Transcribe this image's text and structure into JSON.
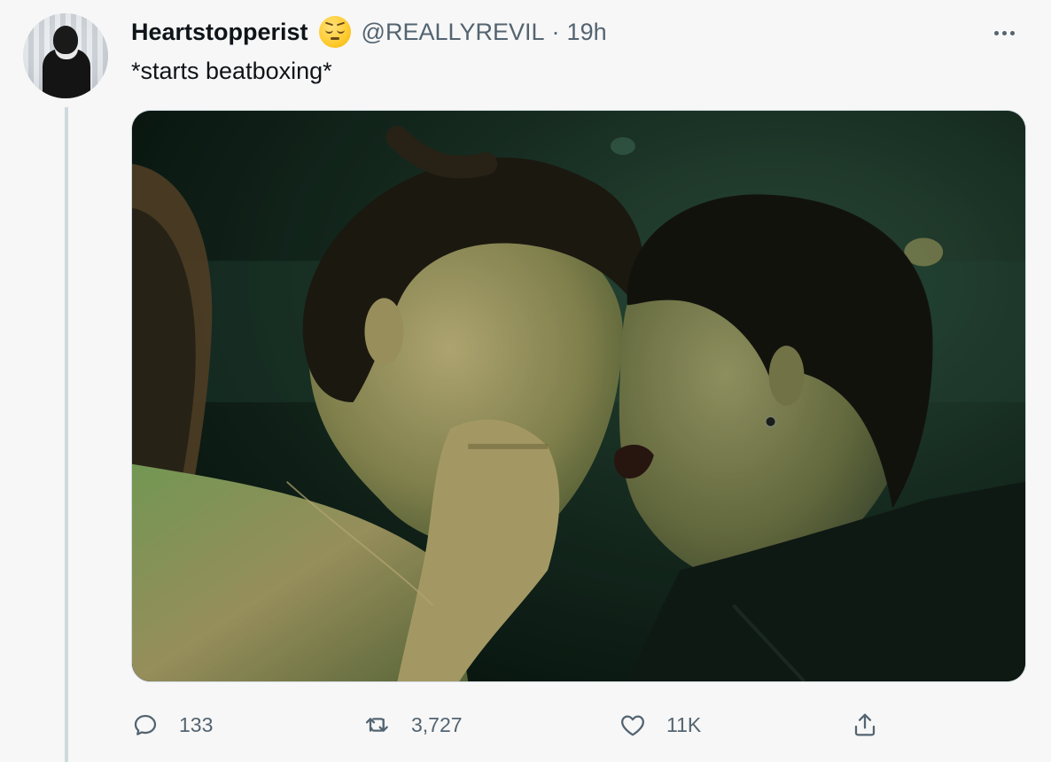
{
  "author": {
    "display_name": "Heartstopperist",
    "emoji": "pensive-face",
    "handle": "@REALLYREVIL",
    "separator": "·",
    "timestamp": "19h"
  },
  "tweet": {
    "text": "*starts beatboxing*"
  },
  "media": {
    "kind": "video-still",
    "dominant_colors": [
      "#0d1a14",
      "#2f5a3a",
      "#b9a574"
    ]
  },
  "actions": {
    "replies": "133",
    "retweets": "3,727",
    "likes": "11K"
  },
  "colors": {
    "text_primary": "#0f1419",
    "text_secondary": "#536471",
    "thread_line": "#cfd9de",
    "background": "#f7f7f7"
  }
}
